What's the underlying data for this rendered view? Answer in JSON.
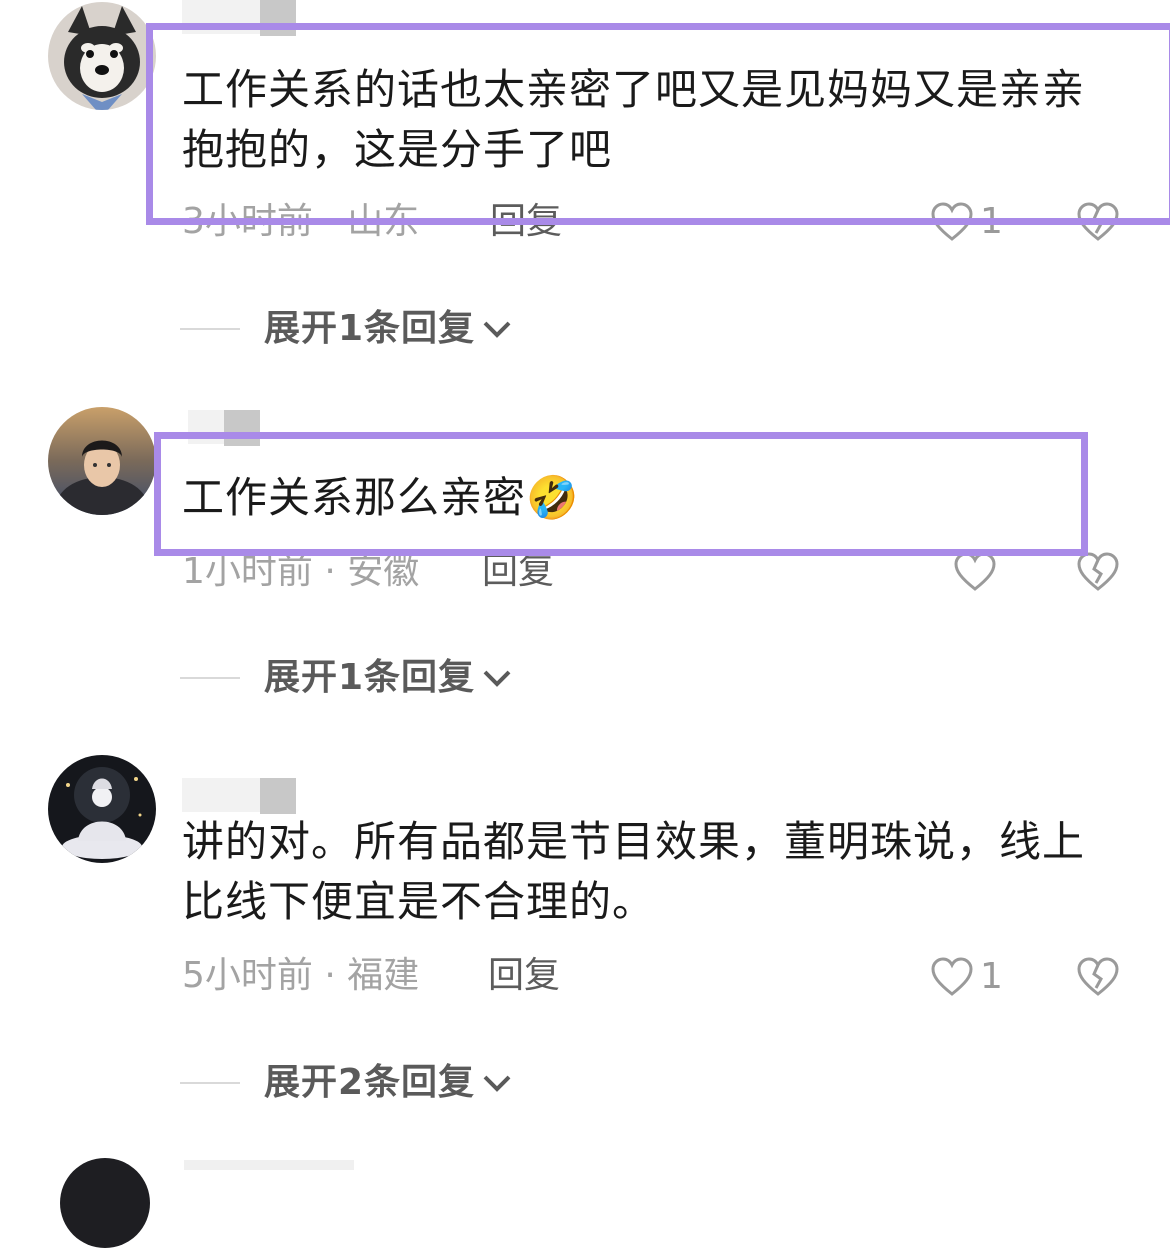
{
  "comments": [
    {
      "text": "工作关系的话也太亲密了吧又是见妈妈又是亲亲抱抱的，这是分手了吧",
      "meta": "3小时前 · 山东",
      "reply_label": "回复",
      "likes": "1",
      "expand_label": "展开1条回复"
    },
    {
      "text": "工作关系那么亲密",
      "emoji": "🤣",
      "meta": "1小时前 · 安徽",
      "reply_label": "回复",
      "likes": "",
      "expand_label": "展开1条回复"
    },
    {
      "text": "讲的对。所有品都是节目效果，董明珠说，线上比线下便宜是不合理的。",
      "meta": "5小时前 · 福建",
      "reply_label": "回复",
      "likes": "1",
      "expand_label": "展开2条回复"
    }
  ],
  "icons": {
    "like": "heart-outline-icon",
    "dislike": "broken-heart-icon",
    "expand": "chevron-down-icon"
  },
  "colors": {
    "highlight": "#a98ae8",
    "text": "#1a1a1a",
    "meta": "#a3a3a3"
  }
}
